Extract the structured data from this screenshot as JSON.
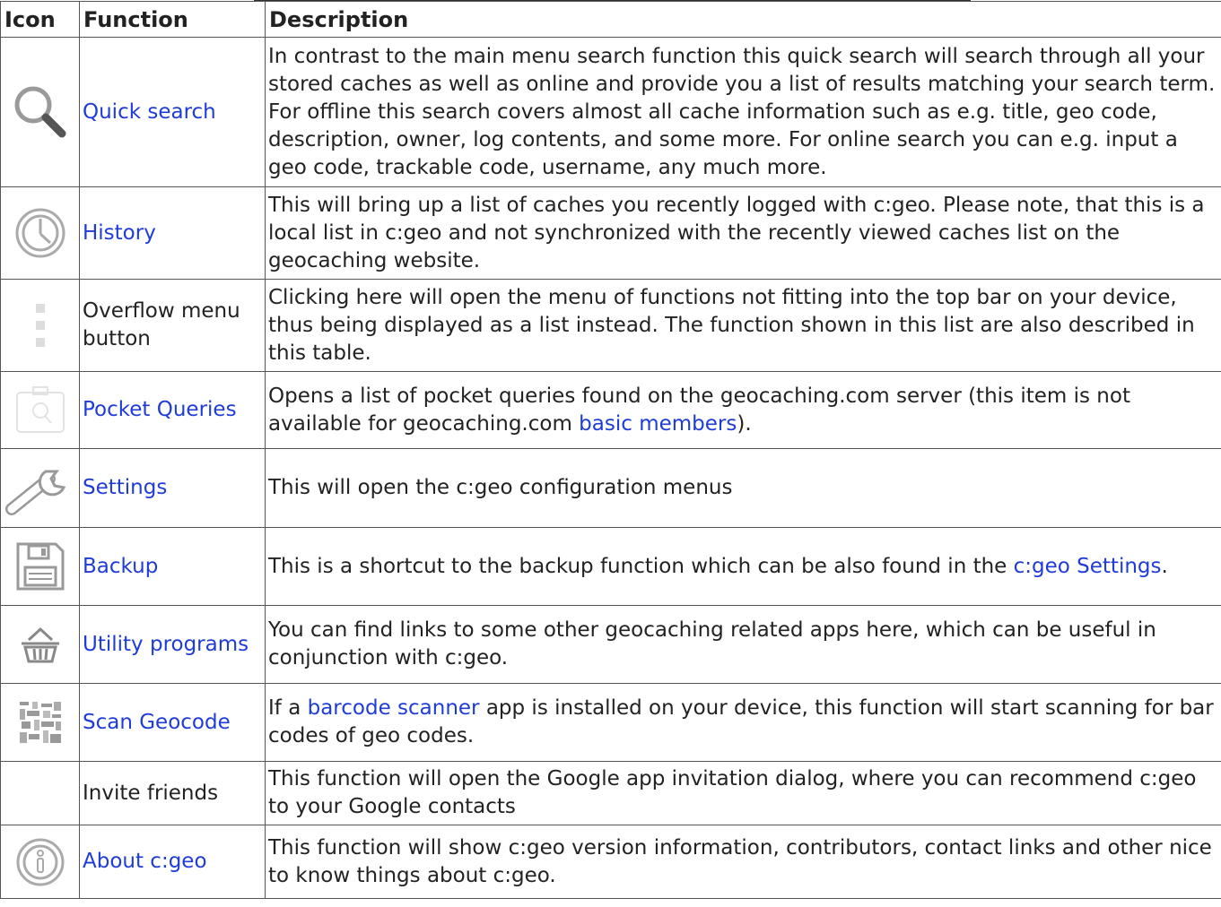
{
  "table": {
    "headers": [
      "Icon",
      "Function",
      "Description"
    ],
    "rows": [
      {
        "icon": "magnifier-icon",
        "function": "Quick search",
        "function_link": true,
        "description": "In contrast to the main menu search function this quick search will search through all your stored caches as well as online and provide you a list of results matching your search term. For offline this search covers almost all cache information such as e.g. title, geo code, description, owner, log contents, and some more. For online search you can e.g. input a geo code, trackable code, username, any much more."
      },
      {
        "icon": "clock-icon",
        "function": "History",
        "function_link": true,
        "description": "This will bring up a list of caches you recently logged with c:geo. Please note, that this is a local list in c:geo and not synchronized with the recently viewed caches list on the geocaching website."
      },
      {
        "icon": "overflow-dots-icon",
        "function": "Overflow menu button",
        "function_link": false,
        "description": "Clicking here will open the menu of functions not fitting into the top bar on your device, thus being displayed as a list instead. The function shown in this list are also described in this table."
      },
      {
        "icon": "pocket-query-icon",
        "function": "Pocket Queries",
        "function_link": true,
        "description_pre": "Opens a list of pocket queries found on the geocaching.com server (this item is not available for geocaching.com ",
        "description_link": "basic members",
        "description_post": ")."
      },
      {
        "icon": "wrench-icon",
        "function": "Settings",
        "function_link": true,
        "description": "This will open the c:geo configuration menus"
      },
      {
        "icon": "floppy-disk-icon",
        "function": "Backup",
        "function_link": true,
        "description_pre": "This is a shortcut to the backup function which can be also found in the ",
        "description_link": "c:geo Settings",
        "description_post": "."
      },
      {
        "icon": "basket-icon",
        "function": "Utility programs",
        "function_link": true,
        "description": "You can find links to some other geocaching related apps here, which can be useful in conjunction with c:geo."
      },
      {
        "icon": "barcode-icon",
        "function": "Scan Geocode",
        "function_link": true,
        "description_pre": "If a ",
        "description_link": "barcode scanner",
        "description_post": " app is installed on your device, this function will start scanning for bar codes of geo codes."
      },
      {
        "icon": "",
        "function": "Invite friends",
        "function_link": false,
        "description": "This function will open the Google app invitation dialog, where you can recommend c:geo to your Google contacts"
      },
      {
        "icon": "info-icon",
        "function": "About c:geo",
        "function_link": true,
        "description": "This function will show c:geo version information, contributors, contact links and other nice to know things about c:geo."
      }
    ]
  },
  "colors": {
    "link": "#1f3cd6",
    "border": "#555555",
    "icon_gray": "#9a9a9a"
  }
}
